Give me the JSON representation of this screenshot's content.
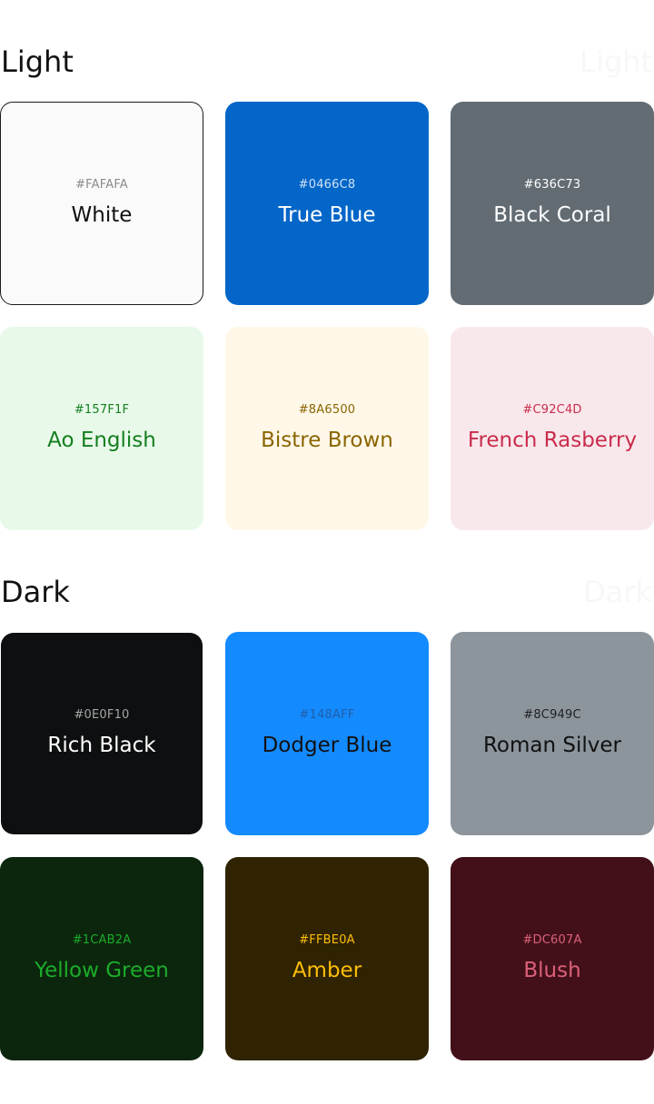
{
  "sections": {
    "light": {
      "title": "Light",
      "ghost_title": "Light",
      "swatches": [
        {
          "hex": "#FAFAFA",
          "name": "White"
        },
        {
          "hex": "#0466C8",
          "name": "True Blue"
        },
        {
          "hex": "#636C73",
          "name": "Black Coral"
        },
        {
          "hex": "#157F1F",
          "name": "Ao English"
        },
        {
          "hex": "#8A6500",
          "name": "Bistre Brown"
        },
        {
          "hex": "#C92C4D",
          "name": "French Rasberry"
        }
      ]
    },
    "dark": {
      "title": "Dark",
      "ghost_title": "Dark",
      "swatches": [
        {
          "hex": "#0E0F10",
          "name": "Rich Black"
        },
        {
          "hex": "#148AFF",
          "name": "Dodger Blue"
        },
        {
          "hex": "#8C949C",
          "name": "Roman Silver"
        },
        {
          "hex": "#1CAB2A",
          "name": "Yellow Green"
        },
        {
          "hex": "#FFBE0A",
          "name": "Amber"
        },
        {
          "hex": "#DC607A",
          "name": "Blush"
        }
      ]
    }
  },
  "colors": {
    "light_backgrounds": [
      "#FAFAFA",
      "#0466C8",
      "#636C73",
      "#E8F9EA",
      "#FFF8E9",
      "#F9E8EB"
    ],
    "dark_backgrounds": [
      "#0E0F10",
      "#148AFF",
      "#8C949C",
      "#0B260D",
      "#2F2302",
      "#431019"
    ]
  }
}
